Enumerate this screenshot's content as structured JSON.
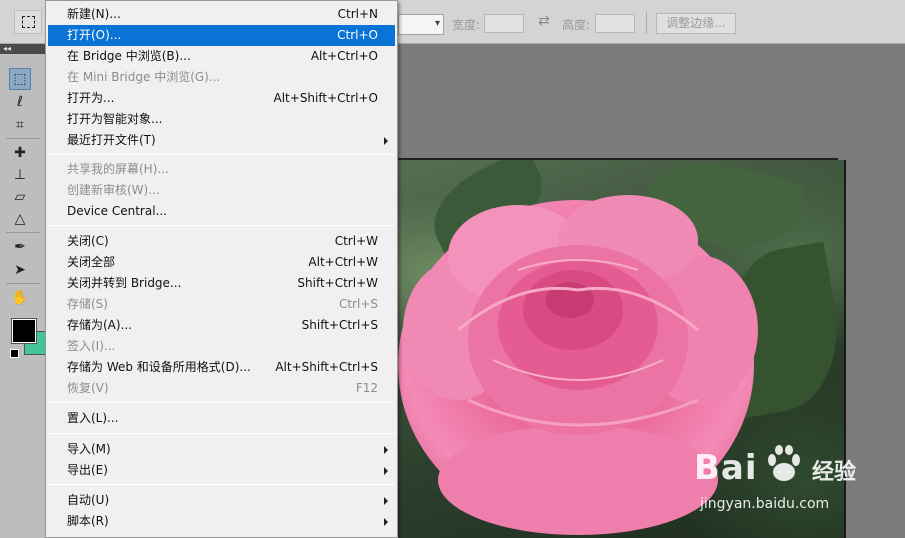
{
  "options_bar": {
    "width_label": "宽度:",
    "height_label": "高度:",
    "refine_edge_label": "调整边缘..."
  },
  "file_menu": {
    "items": [
      {
        "label": "新建(N)...",
        "shortcut": "Ctrl+N",
        "state": "normal"
      },
      {
        "label": "打开(O)...",
        "shortcut": "Ctrl+O",
        "state": "highlighted"
      },
      {
        "label": "在 Bridge 中浏览(B)...",
        "shortcut": "Alt+Ctrl+O",
        "state": "normal"
      },
      {
        "label": "在 Mini Bridge 中浏览(G)...",
        "shortcut": "",
        "state": "disabled"
      },
      {
        "label": "打开为...",
        "shortcut": "Alt+Shift+Ctrl+O",
        "state": "normal"
      },
      {
        "label": "打开为智能对象...",
        "shortcut": "",
        "state": "normal"
      },
      {
        "label": "最近打开文件(T)",
        "shortcut": "",
        "state": "normal",
        "submenu": true
      },
      {
        "label": "共享我的屏幕(H)...",
        "shortcut": "",
        "state": "disabled"
      },
      {
        "label": "创建新审核(W)...",
        "shortcut": "",
        "state": "disabled"
      },
      {
        "label": "Device Central...",
        "shortcut": "",
        "state": "normal"
      },
      {
        "label": "关闭(C)",
        "shortcut": "Ctrl+W",
        "state": "normal"
      },
      {
        "label": "关闭全部",
        "shortcut": "Alt+Ctrl+W",
        "state": "normal"
      },
      {
        "label": "关闭并转到 Bridge...",
        "shortcut": "Shift+Ctrl+W",
        "state": "normal"
      },
      {
        "label": "存储(S)",
        "shortcut": "Ctrl+S",
        "state": "disabled"
      },
      {
        "label": "存储为(A)...",
        "shortcut": "Shift+Ctrl+S",
        "state": "normal"
      },
      {
        "label": "签入(I)...",
        "shortcut": "",
        "state": "disabled"
      },
      {
        "label": "存储为 Web 和设备所用格式(D)...",
        "shortcut": "Alt+Shift+Ctrl+S",
        "state": "normal"
      },
      {
        "label": "恢复(V)",
        "shortcut": "F12",
        "state": "disabled"
      },
      {
        "label": "置入(L)...",
        "shortcut": "",
        "state": "normal"
      },
      {
        "label": "导入(M)",
        "shortcut": "",
        "state": "normal",
        "submenu": true
      },
      {
        "label": "导出(E)",
        "shortcut": "",
        "state": "normal",
        "submenu": true
      },
      {
        "label": "自动(U)",
        "shortcut": "",
        "state": "normal",
        "submenu": true
      },
      {
        "label": "脚本(R)",
        "shortcut": "",
        "state": "normal",
        "submenu": true
      }
    ]
  },
  "toolbox": {
    "foreground_color": "#000000",
    "background_color": "#44c49b"
  },
  "watermark": {
    "brand_left": "Bai",
    "brand_right": "经验",
    "url": "jingyan.baidu.com"
  },
  "colors": {
    "menu_highlight": "#0a74d6",
    "menu_background": "#f0f0f0",
    "workspace": "#7b7b7b"
  }
}
